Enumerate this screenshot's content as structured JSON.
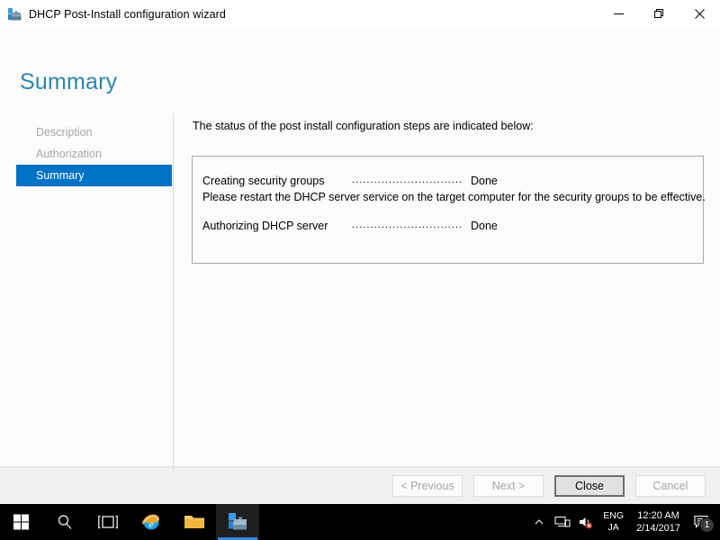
{
  "window": {
    "title": "DHCP Post-Install configuration wizard",
    "icon": "dhcp-toolbox-icon",
    "controls": {
      "minimize": "minimize-button",
      "restore": "restore-button",
      "close": "close-button"
    }
  },
  "page": {
    "title": "Summary"
  },
  "nav": {
    "items": [
      {
        "label": "Description",
        "state": "disabled"
      },
      {
        "label": "Authorization",
        "state": "disabled"
      },
      {
        "label": "Summary",
        "state": "active"
      }
    ]
  },
  "main": {
    "intro": "The status of the post install configuration steps are indicated below:",
    "rows": [
      {
        "label": "Creating security groups",
        "leader": "......................................",
        "value": "Done",
        "note": "Please restart the DHCP server service on the target computer for the security groups to be effective."
      },
      {
        "label": "Authorizing DHCP server",
        "leader": "......................................",
        "value": "Done",
        "note": ""
      }
    ]
  },
  "footer": {
    "buttons": [
      {
        "label": "< Previous",
        "state": "disabled"
      },
      {
        "label": "Next >",
        "state": "disabled"
      },
      {
        "label": "Close",
        "state": "default"
      },
      {
        "label": "Cancel",
        "state": "disabled"
      }
    ]
  },
  "taskbar": {
    "start": "windows-start-icon",
    "items": [
      {
        "name": "search-icon",
        "active": false
      },
      {
        "name": "task-view-icon",
        "active": false
      },
      {
        "name": "internet-explorer-icon",
        "active": false
      },
      {
        "name": "file-explorer-icon",
        "active": false
      },
      {
        "name": "dhcp-wizard-icon",
        "active": true
      }
    ],
    "tray": {
      "overflow": "show-hidden-icons-chevron",
      "network": "network-icon",
      "volume": "volume-muted-icon",
      "language_primary": "ENG",
      "language_secondary": "JA",
      "time": "12:20 AM",
      "date": "2/14/2017",
      "action_center": "action-center-icon",
      "notification_count": "1"
    }
  },
  "colors": {
    "accent_blue": "#0072c6",
    "title_blue": "#2e86ab",
    "taskbar_bg": "#000000",
    "footer_bg": "#f0f0f0"
  }
}
